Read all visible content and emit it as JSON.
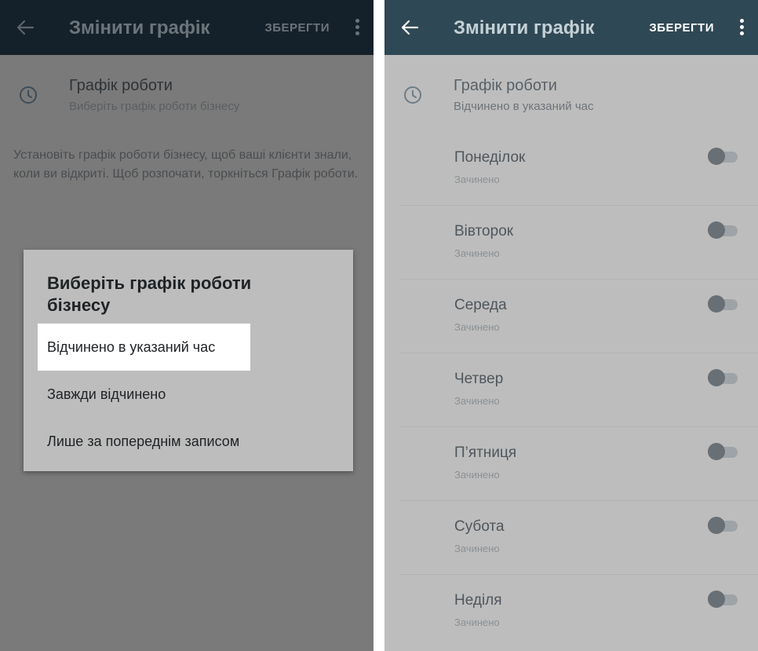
{
  "left": {
    "appbar": {
      "title": "Змінити графік",
      "save": "ЗБЕРЕГТИ"
    },
    "header": {
      "title": "Графік роботи",
      "subtitle": "Виберіть графік роботи бізнесу"
    },
    "helper": "Установіть графік роботи бізнесу, щоб ваші клієнти знали, коли ви відкриті. Щоб розпочати, торкніться Графік роботи.",
    "dialog": {
      "title": "Виберіть графік роботи бізнесу",
      "options": [
        {
          "label": "Відчинено в указаний час",
          "selected": true
        },
        {
          "label": "Завжди відчинено",
          "selected": false
        },
        {
          "label": "Лише за попереднім записом",
          "selected": false
        }
      ]
    }
  },
  "right": {
    "appbar": {
      "title": "Змінити графік",
      "save": "ЗБЕРЕГТИ"
    },
    "header": {
      "title": "Графік роботи",
      "subtitle": "Відчинено в указаний час"
    },
    "days": [
      {
        "name": "Понеділок",
        "status": "Зачинено",
        "on": false
      },
      {
        "name": "Вівторок",
        "status": "Зачинено",
        "on": false
      },
      {
        "name": "Середа",
        "status": "Зачинено",
        "on": false
      },
      {
        "name": "Четвер",
        "status": "Зачинено",
        "on": false
      },
      {
        "name": "П’ятниця",
        "status": "Зачинено",
        "on": false
      },
      {
        "name": "Субота",
        "status": "Зачинено",
        "on": false
      },
      {
        "name": "Неділя",
        "status": "Зачинено",
        "on": false
      }
    ]
  },
  "icons": {
    "back": "arrow-back-icon",
    "more": "more-vert-icon",
    "clock": "clock-icon"
  },
  "colors": {
    "appbar_dark": "#15212a",
    "appbar_light": "#2f4855",
    "scrim": "#7a7a7a",
    "surface": "#bdbdbd"
  }
}
